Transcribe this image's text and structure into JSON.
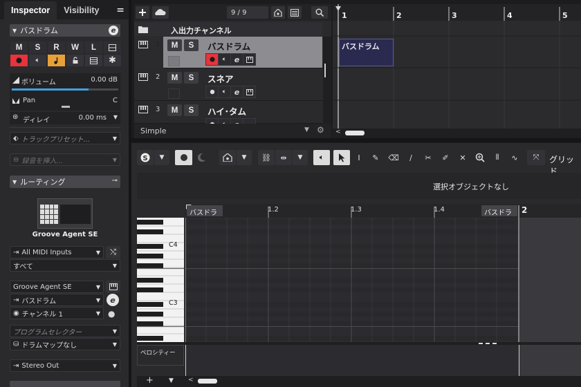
{
  "inspector": {
    "tabs": [
      "Inspector",
      "Visibility"
    ],
    "menu_icon": "menu-icon",
    "track_section_title": "バスドラム",
    "buttons_row1": [
      "M",
      "S",
      "R",
      "W",
      "L"
    ],
    "volume_label": "ボリューム",
    "volume_value": "0.00 dB",
    "volume_level": 0.72,
    "pan_label": "Pan",
    "pan_value": "C",
    "delay_label": "ディレイ",
    "delay_value": "0.00 ms",
    "track_preset": "トラックプリセット...",
    "insert_placeholder": "録音を挿入...",
    "routing_title": "ルーティング",
    "instrument_name": "Groove Agent SE",
    "midi_input": "All MIDI Inputs",
    "midi_channel_in": "すべて",
    "output_instrument": "Groove Agent SE",
    "output_track": "バスドラム",
    "output_channel": "チャンネル 1",
    "program_selector": "プログラムセレクター",
    "drum_map": "ドラムマップなし",
    "audio_out": "Stereo Out"
  },
  "tracklist": {
    "counter": "9 / 9",
    "input_channel_label": "入出力チャンネル",
    "mode": "Simple",
    "tracks": [
      {
        "number": "1",
        "name": "バスドラム",
        "selected": true
      },
      {
        "number": "2",
        "name": "スネア",
        "selected": false
      },
      {
        "number": "3",
        "name": "ハイ･タム",
        "selected": false
      }
    ]
  },
  "arranger": {
    "bars": [
      "1",
      "2",
      "3",
      "4",
      "5"
    ],
    "event_name": "バスドラム"
  },
  "key_editor": {
    "grid_label": "グリッド",
    "status": "選択オブジェクトなし",
    "part_name": "バスドラム",
    "ruler_marks": [
      "1.2",
      "1.3",
      "1.4",
      "2"
    ],
    "octave_labels": [
      "C4",
      "C3"
    ],
    "velocity_label": "ベロシティー"
  },
  "colors": {
    "accent_red": "#e8333c",
    "accent_orange": "#e8a038",
    "volume_blue": "#3fa3e6",
    "selected_track": "#8d8d91",
    "event_bg": "#2a2950"
  }
}
